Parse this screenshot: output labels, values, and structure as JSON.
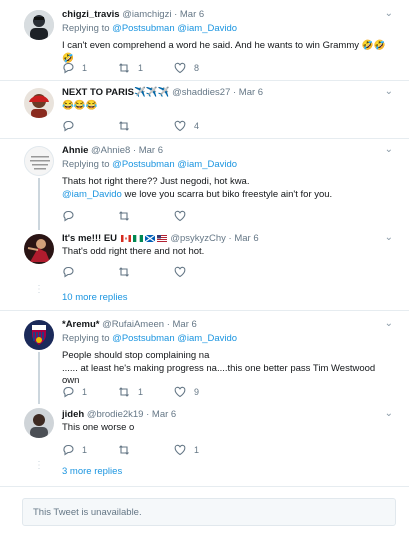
{
  "tweets": [
    {
      "name": "chigzi_travis",
      "handle": "@iamchigzi",
      "date": "· Mar 6",
      "replying_label": "Replying to",
      "replying_to": "@Postsubman @iam_Davido",
      "text": "I can't even comprehend a word he said. And he wants to win Grammy 🤣🤣🤣",
      "reply_count": "1",
      "retweet_count": "1",
      "like_count": "8"
    },
    {
      "name": "NEXT TO PARIS",
      "name_suffix": "✈️✈️✈️",
      "handle": "@shaddies27",
      "date": "· Mar 6",
      "text": "😂😂😂",
      "reply_count": "",
      "retweet_count": "",
      "like_count": "4"
    },
    {
      "name": "Ahnie",
      "handle": "@Ahnie8",
      "date": "· Mar 6",
      "replying_label": "Replying to",
      "replying_to": "@Postsubman @iam_Davido",
      "text_line1": "Thats hot right there?? Just negodi, hot kwa.",
      "text_line2_link": "@iam_Davido",
      "text_line2": " we love you scarra but biko freestyle ain't for you.",
      "reply_count": "",
      "retweet_count": "",
      "like_count": ""
    },
    {
      "name": "It's me!!! EU",
      "handle": "@psykyzChy",
      "date": "· Mar 6",
      "text": "That's odd right there and not hot.",
      "reply_count": "",
      "retweet_count": "",
      "like_count": "",
      "more_replies": "10 more replies"
    },
    {
      "name": "*Aremu*",
      "handle": "@RufaiAmeen",
      "date": "· Mar 6",
      "replying_label": "Replying to",
      "replying_to": "@Postsubman @iam_Davido",
      "text_line1": "People should stop complaining na",
      "text_line2": "...... at least he's making progress na....this one better pass Tim Westwood own",
      "reply_count": "1",
      "retweet_count": "1",
      "like_count": "9"
    },
    {
      "name": "jideh",
      "handle": "@brodie2k19",
      "date": "· Mar 6",
      "text": "This one worse o",
      "reply_count": "1",
      "retweet_count": "",
      "like_count": "1",
      "more_replies": "3 more replies"
    }
  ],
  "unavailable_text": "This Tweet is unavailable.",
  "colors": {
    "link": "#1b95e0",
    "muted": "#657786",
    "separator": "#e6ecf0"
  }
}
